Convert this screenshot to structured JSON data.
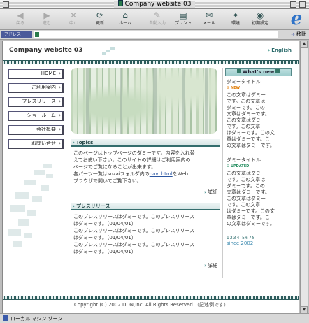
{
  "window": {
    "title": "Company website 03"
  },
  "toolbar": {
    "items": [
      {
        "label": "戻る",
        "icon": "back-arrow-icon",
        "enabled": false
      },
      {
        "label": "進む",
        "icon": "forward-arrow-icon",
        "enabled": false
      },
      {
        "label": "中止",
        "icon": "stop-icon",
        "enabled": false
      },
      {
        "label": "更新",
        "icon": "refresh-icon",
        "enabled": true
      },
      {
        "label": "ホーム",
        "icon": "home-icon",
        "enabled": true
      },
      {
        "label": "自動入力",
        "icon": "autofill-icon",
        "enabled": false
      },
      {
        "label": "プリント",
        "icon": "print-icon",
        "enabled": true
      },
      {
        "label": "メール",
        "icon": "mail-icon",
        "enabled": true
      },
      {
        "label": "環境",
        "icon": "preferences-icon",
        "enabled": true
      },
      {
        "label": "初期設定",
        "icon": "settings-icon",
        "enabled": true
      }
    ]
  },
  "address_bar": {
    "label": "アドレス",
    "value": "",
    "go_label": "移動"
  },
  "page": {
    "site_title": "Company website 03",
    "english_link": "English",
    "nav": [
      "HOME",
      "ご利用案内",
      "プレスリリース",
      "ショールーム",
      "会社概要",
      "お問い合せ"
    ],
    "topics": {
      "heading": "Topics",
      "lines": [
        "このページはトップページのダミーです。内容を入れ替",
        "えてお使い下さい。このサイトの詳細はご利用案内の",
        "ページでご覧になることが出来ます。"
      ],
      "line4_pre": "各パーツ一覧はsozaiフォルダ内の",
      "line4_link": "navi.html",
      "line4_post": "をWeb",
      "line5": "ブラウザで開いてご覧下さい。",
      "more": "詳細"
    },
    "press": {
      "heading": "プレスリリース",
      "lines": [
        "このプレスリリースはダミーです。このプレスリリース",
        "はダミーです。（01/04/01）",
        "このプレスリリースはダミーです。このプレスリリース",
        "はダミーです。（01/04/01）",
        "このプレスリリースはダミーです。このプレスリリース",
        "はダミーです。（01/04/01）"
      ],
      "more": "詳細"
    },
    "whats_new": {
      "heading": "What's new",
      "items": [
        {
          "title": "ダミータイトル",
          "badge": "NEW",
          "lines": [
            "この文章はダミー",
            "です。この文章は",
            "ダミーです。この",
            "文章はダミーです。",
            "この文章はダミー",
            "です。この文章",
            "はダミーです。この文",
            "章はダミーです。こ",
            "の文章はダミーです。"
          ]
        },
        {
          "title": "ダミータイトル",
          "badge": "UPDATED",
          "lines": [
            "この文章はダミー",
            "です。この文章は",
            "ダミーです。この",
            "文章はダミーです。",
            "この文章はダミー",
            "です。この文章",
            "はダミーです。この文",
            "章はダミーです。こ",
            "の文章はダミーです。"
          ]
        }
      ],
      "counter": "1234 5678",
      "since": "since 2002"
    },
    "footer": {
      "copyright": "Copyright (C) 2002 DDN,Inc. All Rights Reserved.（記述例です）"
    }
  },
  "status_bar": {
    "zone": "ローカル マシン ゾーン"
  },
  "colors": {
    "accent_teal": "#2d5c5c",
    "whats_new_bg": "#9ecdcd",
    "link_blue": "#2a55a0",
    "badge_new": "#e07a00",
    "badge_updated": "#1d8a5a"
  }
}
